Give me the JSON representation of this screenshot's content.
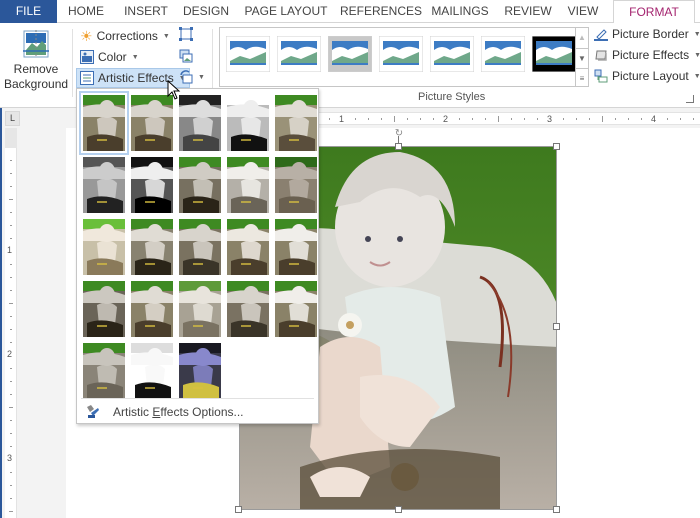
{
  "tabs": [
    {
      "label": "FILE",
      "state": "file"
    },
    {
      "label": "HOME"
    },
    {
      "label": "INSERT"
    },
    {
      "label": "DESIGN"
    },
    {
      "label": "PAGE LAYOUT"
    },
    {
      "label": "REFERENCES"
    },
    {
      "label": "MAILINGS"
    },
    {
      "label": "REVIEW"
    },
    {
      "label": "VIEW"
    },
    {
      "label": "FORMAT",
      "state": "active"
    }
  ],
  "ribbon": {
    "remove_background": {
      "line1": "Remove",
      "line2": "Background",
      "icon": "remove-background-icon"
    },
    "adjust": {
      "corrections": {
        "label": "Corrections",
        "icon": "sun-icon"
      },
      "color": {
        "label": "Color",
        "icon": "color-icon"
      },
      "artistic_effects": {
        "label": "Artistic Effects",
        "icon": "artistic-effects-icon",
        "state": "open"
      }
    },
    "small_buttons": [
      {
        "name": "compress-pictures",
        "icon": "compress-pictures-icon"
      },
      {
        "name": "change-picture",
        "icon": "change-picture-icon"
      },
      {
        "name": "reset-picture",
        "icon": "reset-picture-icon",
        "has_dropdown": true
      }
    ],
    "picture_styles": {
      "label": "Picture Styles",
      "styles_count": 7,
      "selected_last_style": "black-frame"
    },
    "right": {
      "picture_border": {
        "label": "Picture Border",
        "icon": "picture-border-icon"
      },
      "picture_effects": {
        "label": "Picture Effects",
        "icon": "picture-effects-icon"
      },
      "picture_layout": {
        "label": "Picture Layout",
        "icon": "picture-layout-icon"
      }
    }
  },
  "ruler": {
    "horizontal_numbers": [
      "1",
      "2",
      "3",
      "4"
    ],
    "vertical_numbers": [
      "1",
      "2",
      "3"
    ],
    "tab_selector": "L"
  },
  "dropdown": {
    "effects_rows": [
      [
        "None",
        "Marker",
        "Pencil Grayscale",
        "Pencil Sketch",
        "Line Drawing"
      ],
      [
        "Chalk Sketch",
        "Paint Strokes",
        "Paint Brush",
        "Glow Diffused",
        "Blur"
      ],
      [
        "Light Screen",
        "Watercolor Sponge",
        "Film Grain",
        "Mosaic Bubbles",
        "Glass"
      ],
      [
        "Cement",
        "Texturizer",
        "Crisscross Etching",
        "Pastels Smooth",
        "Plastic Wrap"
      ],
      [
        "Cutout",
        "Photocopy",
        "Glow Edges"
      ]
    ],
    "selected": "None",
    "options_label_pre": "Artistic ",
    "options_label_u": "E",
    "options_label_post": "ffects Options...",
    "options_icon": "artistic-effects-options-icon"
  },
  "colors": {
    "file_tab": "#2b579a",
    "format_tab_text": "#a4246f",
    "hover_blue": "#cde2f7",
    "grass": "#4e8a2a"
  }
}
